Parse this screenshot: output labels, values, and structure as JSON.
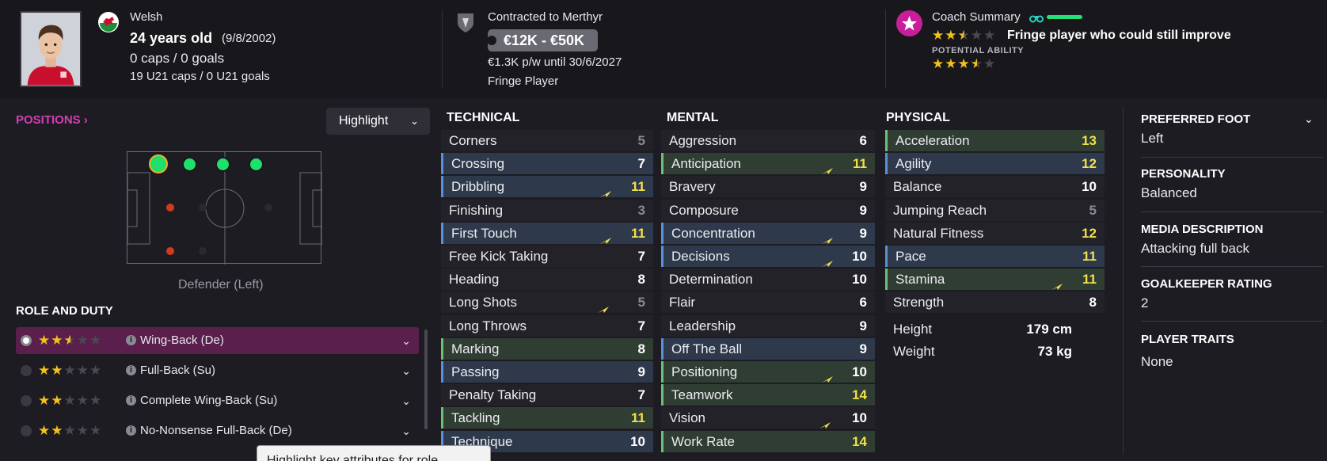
{
  "header": {
    "nationality": "Welsh",
    "age": "24 years old",
    "dob": "(9/8/2002)",
    "caps_goals": "0 caps / 0 goals",
    "u21": "19 U21 caps / 0 U21 goals",
    "contract_title": "Contracted to Merthyr",
    "value_range": "€12K - €50K",
    "wage": "€1.3K p/w until 30/6/2027",
    "squad_status": "Fringe Player",
    "coach_summary_label": "Coach Summary",
    "coach_summary_text": "Fringe player who could still improve",
    "potential_label": "POTENTIAL ABILITY",
    "current_ability_stars": 2.5,
    "potential_ability_stars": 3.5,
    "accent_colors": {
      "coach": "#c81e9a",
      "binoculars": "#23d1c0",
      "bar": "#22e07a"
    }
  },
  "positions": {
    "title": "POSITIONS",
    "title_chevron": "›",
    "highlight_label": "Highlight",
    "position_label": "Defender (Left)",
    "dot_colors": {
      "natural": "#1ee06a",
      "poor": "#d23a1e",
      "unused": "#2a2930"
    }
  },
  "roles": {
    "title": "ROLE AND DUTY",
    "items": [
      {
        "name": "Wing-Back (De)",
        "stars": 2.5,
        "selected": true
      },
      {
        "name": "Full-Back (Su)",
        "stars": 2,
        "selected": false
      },
      {
        "name": "Complete Wing-Back (Su)",
        "stars": 2,
        "selected": false
      },
      {
        "name": "No-Nonsense Full-Back (De)",
        "stars": 2,
        "selected": false
      }
    ],
    "tooltip": "Highlight key attributes for role"
  },
  "technical": {
    "title": "TECHNICAL",
    "rows": [
      {
        "name": "Corners",
        "value": "5",
        "bg": "plain",
        "color": "grey",
        "arrow": false
      },
      {
        "name": "Crossing",
        "value": "7",
        "bg": "blue",
        "color": "white",
        "arrow": false
      },
      {
        "name": "Dribbling",
        "value": "11",
        "bg": "blue",
        "color": "yellow",
        "arrow": true
      },
      {
        "name": "Finishing",
        "value": "3",
        "bg": "plain",
        "color": "grey",
        "arrow": false
      },
      {
        "name": "First Touch",
        "value": "11",
        "bg": "blue",
        "color": "yellow",
        "arrow": true
      },
      {
        "name": "Free Kick Taking",
        "value": "7",
        "bg": "plain",
        "color": "white",
        "arrow": false
      },
      {
        "name": "Heading",
        "value": "8",
        "bg": "plain",
        "color": "white",
        "arrow": false
      },
      {
        "name": "Long Shots",
        "value": "5",
        "bg": "plain",
        "color": "grey",
        "arrow": true
      },
      {
        "name": "Long Throws",
        "value": "7",
        "bg": "plain",
        "color": "white",
        "arrow": false
      },
      {
        "name": "Marking",
        "value": "8",
        "bg": "green",
        "color": "white",
        "arrow": false
      },
      {
        "name": "Passing",
        "value": "9",
        "bg": "blue",
        "color": "white",
        "arrow": false
      },
      {
        "name": "Penalty Taking",
        "value": "7",
        "bg": "plain",
        "color": "white",
        "arrow": false
      },
      {
        "name": "Tackling",
        "value": "11",
        "bg": "green",
        "color": "yellow",
        "arrow": false
      },
      {
        "name": "Technique",
        "value": "10",
        "bg": "blue",
        "color": "white",
        "arrow": false
      }
    ]
  },
  "mental": {
    "title": "MENTAL",
    "rows": [
      {
        "name": "Aggression",
        "value": "6",
        "bg": "plain",
        "color": "white",
        "arrow": false
      },
      {
        "name": "Anticipation",
        "value": "11",
        "bg": "green",
        "color": "yellow",
        "arrow": true
      },
      {
        "name": "Bravery",
        "value": "9",
        "bg": "plain",
        "color": "white",
        "arrow": false
      },
      {
        "name": "Composure",
        "value": "9",
        "bg": "plain",
        "color": "white",
        "arrow": false
      },
      {
        "name": "Concentration",
        "value": "9",
        "bg": "blue",
        "color": "white",
        "arrow": true
      },
      {
        "name": "Decisions",
        "value": "10",
        "bg": "blue",
        "color": "white",
        "arrow": true
      },
      {
        "name": "Determination",
        "value": "10",
        "bg": "plain",
        "color": "white",
        "arrow": false
      },
      {
        "name": "Flair",
        "value": "6",
        "bg": "plain",
        "color": "white",
        "arrow": false
      },
      {
        "name": "Leadership",
        "value": "9",
        "bg": "plain",
        "color": "white",
        "arrow": false
      },
      {
        "name": "Off The Ball",
        "value": "9",
        "bg": "blue",
        "color": "white",
        "arrow": false
      },
      {
        "name": "Positioning",
        "value": "10",
        "bg": "green",
        "color": "white",
        "arrow": true
      },
      {
        "name": "Teamwork",
        "value": "14",
        "bg": "green",
        "color": "yellow",
        "arrow": false
      },
      {
        "name": "Vision",
        "value": "10",
        "bg": "plain",
        "color": "white",
        "arrow": true
      },
      {
        "name": "Work Rate",
        "value": "14",
        "bg": "green",
        "color": "yellow",
        "arrow": false
      }
    ]
  },
  "physical": {
    "title": "PHYSICAL",
    "rows": [
      {
        "name": "Acceleration",
        "value": "13",
        "bg": "green",
        "color": "yellow",
        "arrow": false
      },
      {
        "name": "Agility",
        "value": "12",
        "bg": "blue",
        "color": "yellow",
        "arrow": false
      },
      {
        "name": "Balance",
        "value": "10",
        "bg": "plain",
        "color": "white",
        "arrow": false
      },
      {
        "name": "Jumping Reach",
        "value": "5",
        "bg": "plain",
        "color": "grey",
        "arrow": false
      },
      {
        "name": "Natural Fitness",
        "value": "12",
        "bg": "plain",
        "color": "yellow",
        "arrow": false
      },
      {
        "name": "Pace",
        "value": "11",
        "bg": "blue",
        "color": "yellow",
        "arrow": false
      },
      {
        "name": "Stamina",
        "value": "11",
        "bg": "green",
        "color": "yellow",
        "arrow": true
      },
      {
        "name": "Strength",
        "value": "8",
        "bg": "plain",
        "color": "white",
        "arrow": false
      }
    ],
    "height_label": "Height",
    "height_value": "179 cm",
    "weight_label": "Weight",
    "weight_value": "73 kg"
  },
  "info": {
    "preferred_foot_label": "PREFERRED FOOT",
    "preferred_foot": "Left",
    "personality_label": "PERSONALITY",
    "personality": "Balanced",
    "media_label": "MEDIA DESCRIPTION",
    "media": "Attacking full back",
    "gk_label": "GOALKEEPER RATING",
    "gk": "2",
    "traits_label": "PLAYER TRAITS",
    "traits": "None"
  }
}
